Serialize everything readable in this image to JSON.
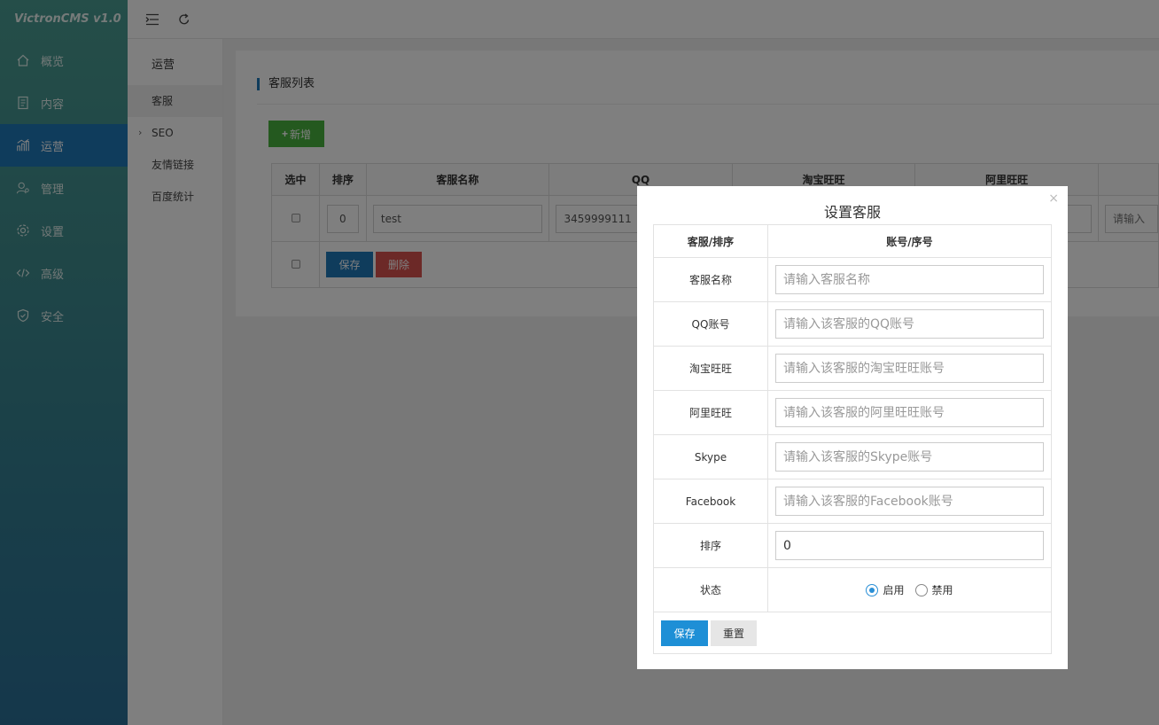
{
  "brand": "VictronCMS v1.0",
  "sidebar": {
    "items": [
      {
        "label": "概览",
        "icon": "home-icon"
      },
      {
        "label": "内容",
        "icon": "document-icon"
      },
      {
        "label": "运营",
        "icon": "chart-icon",
        "active": true
      },
      {
        "label": "管理",
        "icon": "user-icon"
      },
      {
        "label": "设置",
        "icon": "gear-icon"
      },
      {
        "label": "高级",
        "icon": "code-icon"
      },
      {
        "label": "安全",
        "icon": "shield-icon"
      }
    ]
  },
  "topbar": {
    "menu_icon": "menu-indent-icon",
    "refresh_icon": "refresh-icon"
  },
  "submenu": {
    "title": "运营",
    "items": [
      {
        "label": "客服",
        "active": true
      },
      {
        "label": "SEO",
        "caret": "›"
      },
      {
        "label": "友情链接"
      },
      {
        "label": "百度统计"
      }
    ]
  },
  "panel": {
    "title": "客服列表",
    "new_button": "新增",
    "new_icon": "+",
    "columns": [
      "选中",
      "排序",
      "客服名称",
      "QQ",
      "淘宝旺旺",
      "阿里旺旺",
      ""
    ],
    "row": {
      "order": "0",
      "name": "test",
      "qq": "3459999111",
      "last_placeholder": "请输入"
    },
    "save_button": "保存",
    "delete_button": "删除"
  },
  "modal": {
    "title": "设置客服",
    "close": "×",
    "header_left": "客服/排序",
    "header_right": "账号/序号",
    "fields": [
      {
        "label": "客服名称",
        "placeholder": "请输入客服名称",
        "value": ""
      },
      {
        "label": "QQ账号",
        "placeholder": "请输入该客服的QQ账号",
        "value": ""
      },
      {
        "label": "淘宝旺旺",
        "placeholder": "请输入该客服的淘宝旺旺账号",
        "value": ""
      },
      {
        "label": "阿里旺旺",
        "placeholder": "请输入该客服的阿里旺旺账号",
        "value": ""
      },
      {
        "label": "Skype",
        "placeholder": "请输入该客服的Skype账号",
        "value": ""
      },
      {
        "label": "Facebook",
        "placeholder": "请输入该客服的Facebook账号",
        "value": ""
      },
      {
        "label": "排序",
        "placeholder": "",
        "value": "0"
      }
    ],
    "status_label": "状态",
    "status_enabled": "启用",
    "status_disabled": "禁用",
    "save_button": "保存",
    "reset_button": "重置"
  },
  "colors": {
    "accent": "#1e78b9",
    "success": "#49b33f",
    "danger": "#d9534f"
  }
}
